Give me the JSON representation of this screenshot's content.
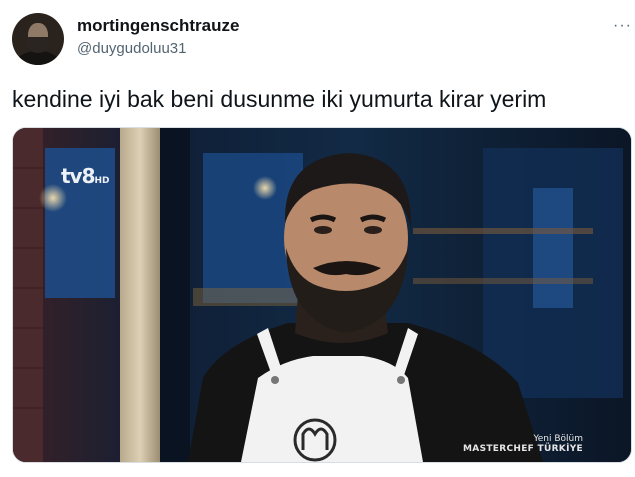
{
  "user": {
    "display_name": "mortingenschtrauze",
    "handle": "@duygudoluu31"
  },
  "more_glyph": "···",
  "tweet": {
    "text": "kendine iyi bak beni dusunme iki yumurta kirar yerim"
  },
  "media": {
    "channel_logo": "tv8",
    "channel_logo_suffix": "HD",
    "caption_line1": "Yeni Bölüm",
    "caption_line2": "MASTERCHEF TÜRKİYE"
  }
}
